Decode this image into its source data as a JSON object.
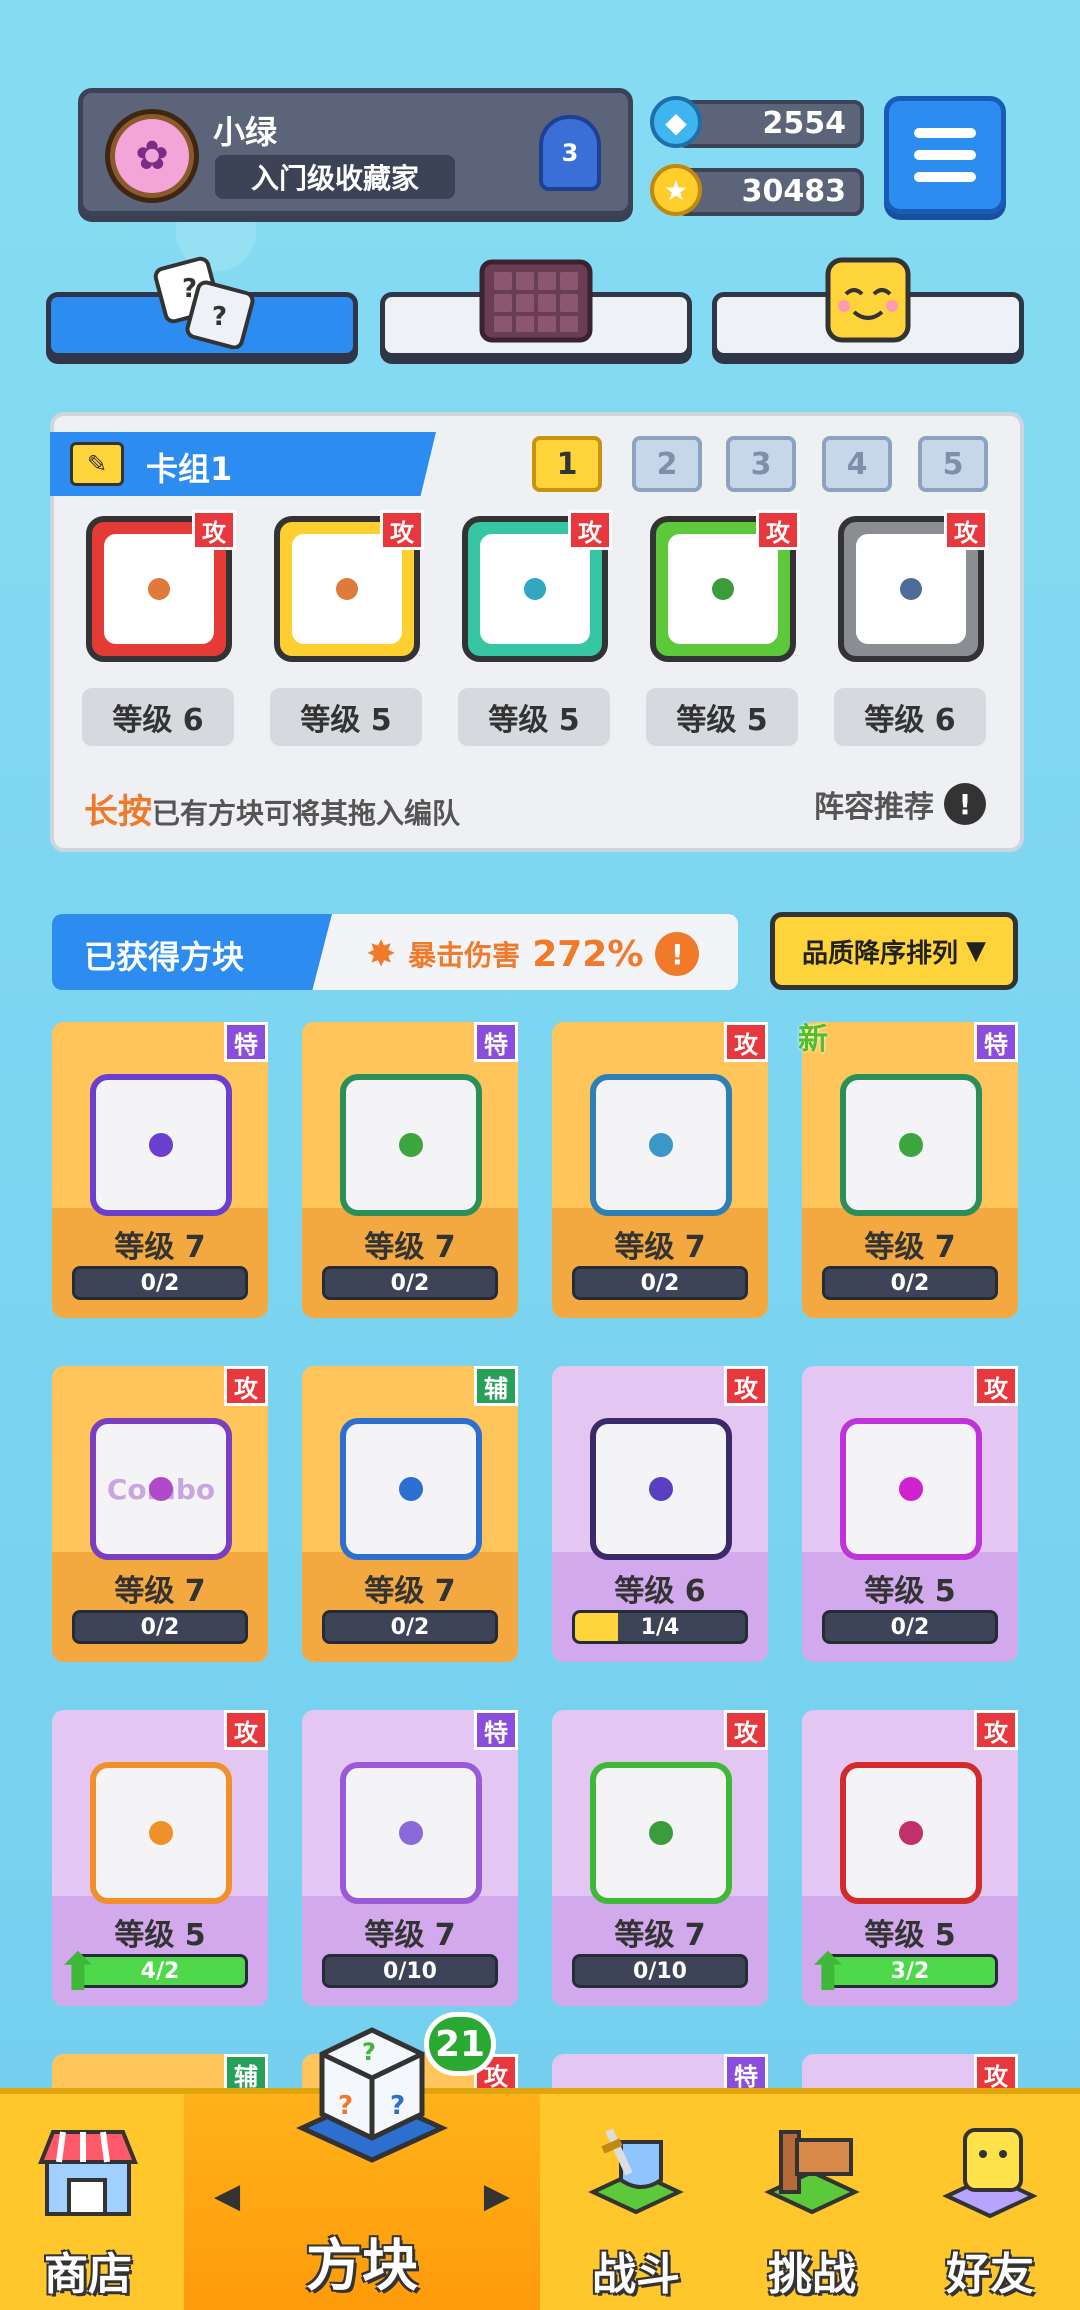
{
  "profile": {
    "name": "小绿",
    "title": "入门级收藏家",
    "rank": "3"
  },
  "currency": {
    "gems": "2554",
    "coins": "30483"
  },
  "deck": {
    "label": "卡组1",
    "tabs": [
      "1",
      "2",
      "3",
      "4",
      "5"
    ],
    "active_tab": 0,
    "cards": [
      {
        "color": "#e43b37",
        "pip": "#e07a3a",
        "tag": "攻",
        "level": "等级 6"
      },
      {
        "color": "#ffcf2f",
        "pip": "#e07a3a",
        "tag": "攻",
        "level": "等级 5"
      },
      {
        "color": "#36c6a4",
        "pip": "#2fa8c0",
        "tag": "攻",
        "level": "等级 5"
      },
      {
        "color": "#5cc93a",
        "pip": "#3a9c3a",
        "tag": "攻",
        "level": "等级 5"
      },
      {
        "color": "#8a8d92",
        "pip": "#4f6b99",
        "tag": "攻",
        "level": "等级 6"
      }
    ],
    "hint_highlight": "长按",
    "hint_text": "已有方块可将其拖入编队",
    "recommend": "阵容推荐"
  },
  "owned": {
    "title": "已获得方块",
    "crit_label": "暴击伤害",
    "crit_value": "272%",
    "sort_label": "品质降序排列"
  },
  "grid": [
    {
      "rarity": "legend",
      "tag": "特",
      "tag_color": "#8b4ddb",
      "border": "#6a3fd0",
      "pip": "#6a3fd0",
      "level": "等级 7",
      "progress": "0/2",
      "fill": 0,
      "new": false
    },
    {
      "rarity": "legend",
      "tag": "特",
      "tag_color": "#8b4ddb",
      "border": "#2b8f5a",
      "pip": "#3da53d",
      "level": "等级 7",
      "progress": "0/2",
      "fill": 0,
      "new": false
    },
    {
      "rarity": "legend",
      "tag": "攻",
      "tag_color": "#e8383d",
      "border": "#2d7fb5",
      "pip": "#3a98c7",
      "level": "等级 7",
      "progress": "0/2",
      "fill": 0,
      "new": false
    },
    {
      "rarity": "legend",
      "tag": "特",
      "tag_color": "#8b4ddb",
      "border": "#2b8f5a",
      "pip": "#3da53d",
      "level": "等级 7",
      "progress": "0/2",
      "fill": 0,
      "new": true,
      "new_label": "新"
    },
    {
      "rarity": "legend",
      "tag": "攻",
      "tag_color": "#e8383d",
      "border": "#7a3fc0",
      "pip": "#b04ac9",
      "level": "等级 7",
      "progress": "0/2",
      "fill": 0,
      "new": false,
      "text": "Combo"
    },
    {
      "rarity": "legend",
      "tag": "辅",
      "tag_color": "#27a05a",
      "border": "#2d6fd0",
      "pip": "#2d6fd0",
      "level": "等级 7",
      "progress": "0/2",
      "fill": 0,
      "new": false
    },
    {
      "rarity": "epic",
      "tag": "攻",
      "tag_color": "#e8383d",
      "border": "#3a2a6a",
      "pip": "#5a3fc0",
      "level": "等级 6",
      "progress": "1/4",
      "fill": 0.25,
      "new": false
    },
    {
      "rarity": "epic",
      "tag": "攻",
      "tag_color": "#e8383d",
      "border": "#c033d8",
      "pip": "#d020d0",
      "level": "等级 5",
      "progress": "0/2",
      "fill": 0,
      "new": false
    },
    {
      "rarity": "epic",
      "tag": "攻",
      "tag_color": "#e8383d",
      "border": "#f0902a",
      "pip": "#f0902a",
      "level": "等级 5",
      "progress": "4/2",
      "fill": 1,
      "green": true,
      "up": true,
      "new": false
    },
    {
      "rarity": "epic",
      "tag": "特",
      "tag_color": "#8b4ddb",
      "border": "#9a5ad8",
      "pip": "#8a6ad8",
      "level": "等级 7",
      "progress": "0/10",
      "fill": 0,
      "new": false
    },
    {
      "rarity": "epic",
      "tag": "攻",
      "tag_color": "#e8383d",
      "border": "#3fb83a",
      "pip": "#3a9c3a",
      "level": "等级 7",
      "progress": "0/10",
      "fill": 0,
      "new": false
    },
    {
      "rarity": "epic",
      "tag": "攻",
      "tag_color": "#e8383d",
      "border": "#d32b2b",
      "pip": "#c0306a",
      "level": "等级 5",
      "progress": "3/2",
      "fill": 1,
      "green": true,
      "up": true,
      "new": false
    }
  ],
  "partial_tags": [
    "辅",
    "攻",
    "特",
    "攻"
  ],
  "nav": {
    "shop": "商店",
    "blocks": "方块",
    "battle": "战斗",
    "challenge": "挑战",
    "friends": "好友",
    "blocks_badge": "21"
  }
}
